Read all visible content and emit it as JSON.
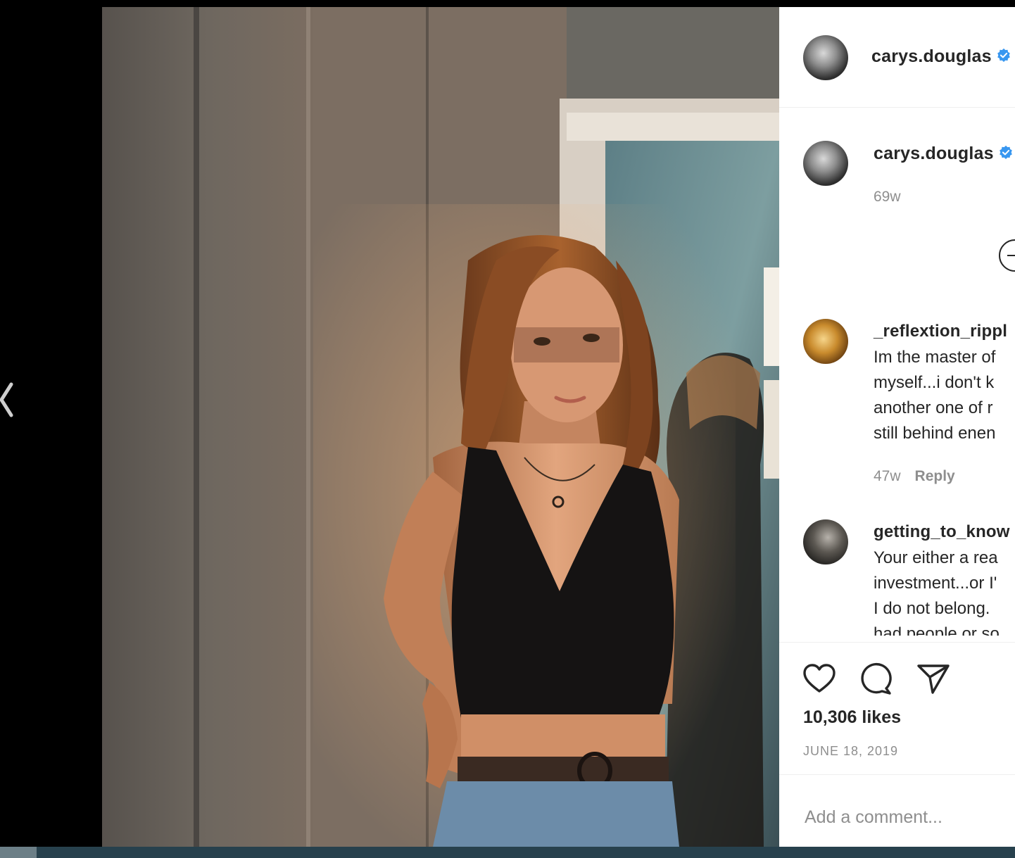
{
  "post": {
    "author": "carys.douglas",
    "verified": true,
    "image_alt": "Young woman in black tank top standing in warm sunlight beside a mirror"
  },
  "caption": {
    "author": "carys.douglas",
    "time": "69w"
  },
  "comments": [
    {
      "username": "_reflextion_rippl",
      "lines": [
        "Im the master of",
        "myself...i don't k",
        "another one of r",
        "still behind enen"
      ],
      "time": "47w",
      "reply_label": "Reply"
    },
    {
      "username": "getting_to_know",
      "lines": [
        "Your either a rea",
        "investment...or I'",
        "I do not belong.",
        "had people or so"
      ]
    }
  ],
  "actions": {
    "like_icon": "heart-icon",
    "comment_icon": "comment-icon",
    "share_icon": "paper-plane-icon"
  },
  "likes": "10,306 likes",
  "date": "JUNE 18, 2019",
  "add_comment": {
    "placeholder": "Add a comment..."
  },
  "colors": {
    "verified": "#3897f0",
    "text": "#262626",
    "muted": "#8e8e8e",
    "taskbar": "#27414d"
  }
}
